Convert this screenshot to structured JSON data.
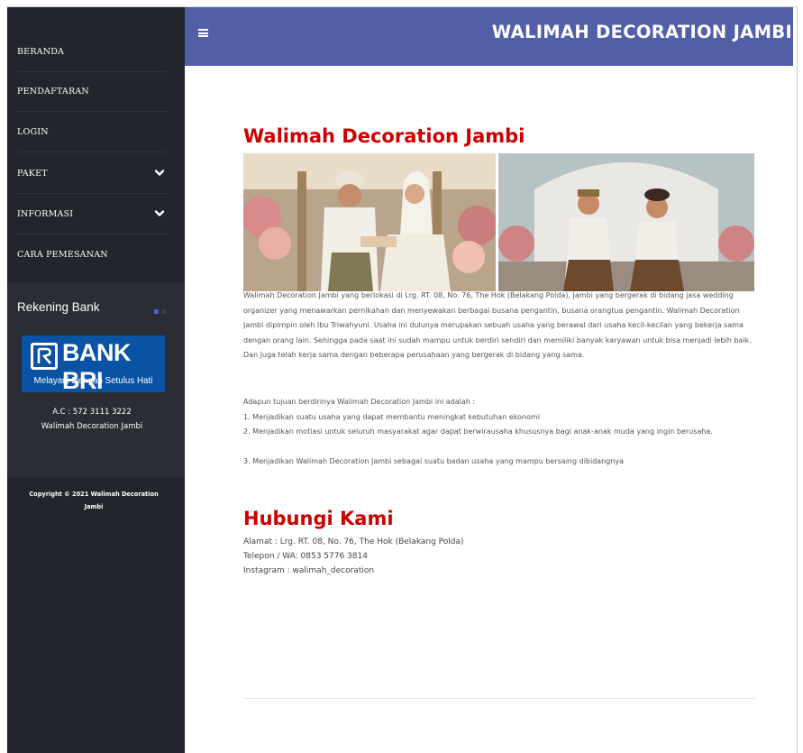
{
  "sidebar": {
    "items": [
      {
        "label": "BERANDA",
        "has_submenu": false
      },
      {
        "label": "PENDAFTARAN",
        "has_submenu": false
      },
      {
        "label": "LOGIN",
        "has_submenu": false
      },
      {
        "label": "PAKET",
        "has_submenu": true
      },
      {
        "label": "INFORMASI",
        "has_submenu": true
      },
      {
        "label": "CARA PEMESANAN",
        "has_submenu": false
      }
    ],
    "rekening": {
      "title": "Rekening Bank",
      "bank_logo_text": "BANK BRI",
      "bank_tagline": "Melayani Dengan Setulus Hati",
      "account_number": "A.C : 572 3111 3222",
      "account_name": "Walimah Decoration Jambi"
    },
    "copyright": "Copyright © 2021 Walimah Decoration Jambi"
  },
  "header": {
    "menu_icon": "hamburger-icon",
    "brand": "WALIMAH DECORATION JAMBI"
  },
  "main": {
    "title": "Walimah Decoration Jambi",
    "photos": [
      "wedding-ring-ceremony-photo",
      "bride-groom-seated-photo"
    ],
    "description": "Walimah Decoration Jambi yang berlokasi di Lrg. RT. 08, No. 76, The Hok (Belakang Polda), Jambi yang bergerak di bidang jasa wedding organizer yang menawarkan pernikahan dan menyewakan berbagai busana pengantin, busana orangtua pengantin. Walimah Decoration Jambi dipimpin oleh Ibu Triwahyuni. Usaha ini dulunya merupakan sebuah usaha yang berawal dari usaha kecil-kecilan yang bekerja sama dengan orang lain. Sehingga pada saat ini sudah mampu untuk berdiri sendiri dan memiliki banyak karyawan untuk bisa menjadi lebih baik. Dan juga telah kerja sama dengan beberapa perusahaan yang bergerak di bidang yang sama.",
    "goals_intro": "Adapun tujuan berdirinya Walimah Decoration Jambi ini adalah :",
    "goals": [
      "1. Menjadikan suatu usaha yang dapat membantu meningkat kebutuhan ekonomi",
      "2. Menjadikan motiasi untuk seluruh masyarakat agar dapat berwirausaha khususnya bagi anak-anak muda yang ingin berusaha.",
      "3. Menjadikan Walimah Decoration Jambi sebagai suatu badan usaha yang mampu bersaing dibidangnya"
    ]
  },
  "contact": {
    "title": "Hubungi Kami",
    "address": "Alamat : Lrg. RT. 08, No. 76, The Hok (Belakang Polda)",
    "phone": "Telepon / WA: 0853 5776 3814",
    "instagram": "Instagram : walimah_decoration"
  },
  "colors": {
    "sidebar_bg": "#23252c",
    "topbar_bg": "#525ea6",
    "heading_red": "#cc0000",
    "bank_blue": "#0a52a3"
  }
}
